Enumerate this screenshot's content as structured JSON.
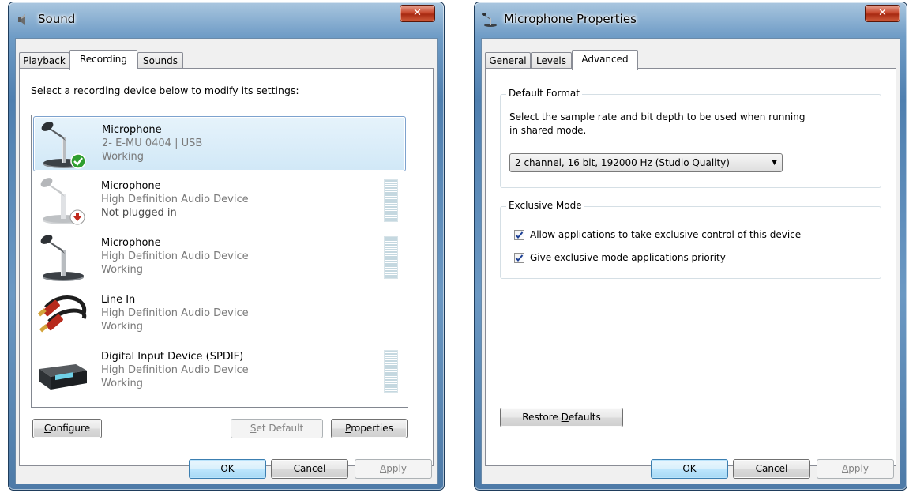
{
  "sound_window": {
    "title": "Sound",
    "tabs": [
      {
        "label": "Playback",
        "active": false
      },
      {
        "label": "Recording",
        "active": true
      },
      {
        "label": "Sounds",
        "active": false
      }
    ],
    "instruction": "Select a recording device below to modify its settings:",
    "devices": [
      {
        "name": "Microphone",
        "description": "2- E-MU 0404 | USB",
        "status": "Working",
        "icon": "microphone-icon",
        "badge": "default-check-icon",
        "selected": true,
        "has_meter": false
      },
      {
        "name": "Microphone",
        "description": "High Definition Audio Device",
        "status": "Not plugged in",
        "icon": "microphone-icon",
        "badge": "unplugged-icon",
        "selected": false,
        "has_meter": true
      },
      {
        "name": "Microphone",
        "description": "High Definition Audio Device",
        "status": "Working",
        "icon": "microphone-icon",
        "badge": "",
        "selected": false,
        "has_meter": true
      },
      {
        "name": "Line In",
        "description": "High Definition Audio Device",
        "status": "Working",
        "icon": "rca-cable-icon",
        "badge": "",
        "selected": false,
        "has_meter": false
      },
      {
        "name": "Digital Input Device (SPDIF)",
        "description": "High Definition Audio Device",
        "status": "Working",
        "icon": "spdif-device-icon",
        "badge": "",
        "selected": false,
        "has_meter": true
      }
    ],
    "buttons": {
      "configure": {
        "mnemonic": "C",
        "rest": "onfigure"
      },
      "set_default": {
        "mnemonic": "S",
        "rest": "et Default"
      },
      "properties": {
        "mnemonic": "P",
        "rest": "roperties"
      },
      "ok": "OK",
      "cancel": "Cancel",
      "apply": {
        "mnemonic": "A",
        "rest": "pply"
      }
    }
  },
  "mic_window": {
    "title": "Microphone Properties",
    "tabs": [
      {
        "label": "General",
        "active": false
      },
      {
        "label": "Levels",
        "active": false
      },
      {
        "label": "Advanced",
        "active": true
      }
    ],
    "default_format": {
      "group_label": "Default Format",
      "description_line1": "Select the sample rate and bit depth to be used when running",
      "description_line2": "in shared mode.",
      "selected_format": "2 channel, 16 bit, 192000 Hz (Studio Quality)"
    },
    "exclusive_mode": {
      "group_label": "Exclusive Mode",
      "options": [
        {
          "label": "Allow applications to take exclusive control of this device",
          "checked": true
        },
        {
          "label": "Give exclusive mode applications priority",
          "checked": true
        }
      ]
    },
    "buttons": {
      "restore_defaults": {
        "before": "Restore ",
        "mnemonic": "D",
        "rest": "efaults"
      },
      "ok": "OK",
      "cancel": "Cancel",
      "apply": {
        "mnemonic": "A",
        "rest": "pply"
      }
    }
  },
  "colors": {
    "selection_fill": "#d9ecf8",
    "selection_border": "#7da2ce",
    "check_green": "#2f9e2f",
    "unplugged_red": "#c0281c",
    "close_button_red": "#c8492e"
  }
}
